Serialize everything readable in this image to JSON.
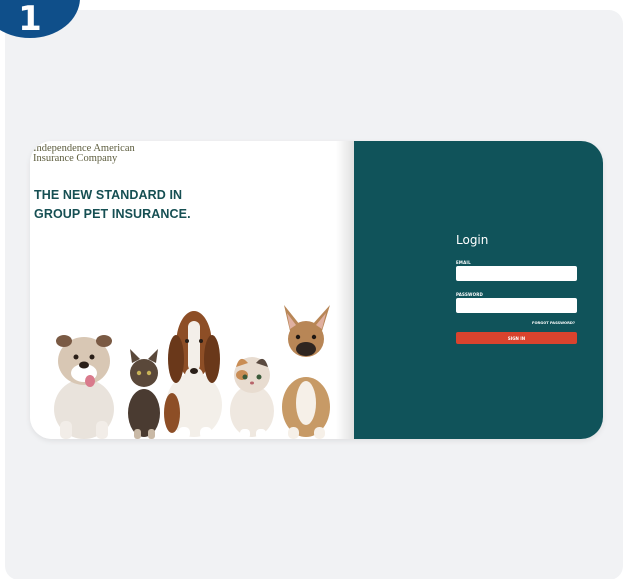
{
  "step": {
    "number": "1"
  },
  "brand": {
    "line1": "Independence American",
    "line2": "Insurance Company"
  },
  "hero": {
    "line1": "THE NEW STANDARD IN",
    "line2": "GROUP PET INSURANCE."
  },
  "login": {
    "title": "Login",
    "email_label": "EMAIL",
    "email_value": "",
    "password_label": "PASSWORD",
    "password_value": "",
    "forgot_label": "FORGOT PASSWORD?",
    "signin_label": "SIGN IN"
  },
  "colors": {
    "badge": "#0f4f8a",
    "panel_right": "#10535a",
    "signin": "#d9432e",
    "tagline": "#164f53"
  }
}
